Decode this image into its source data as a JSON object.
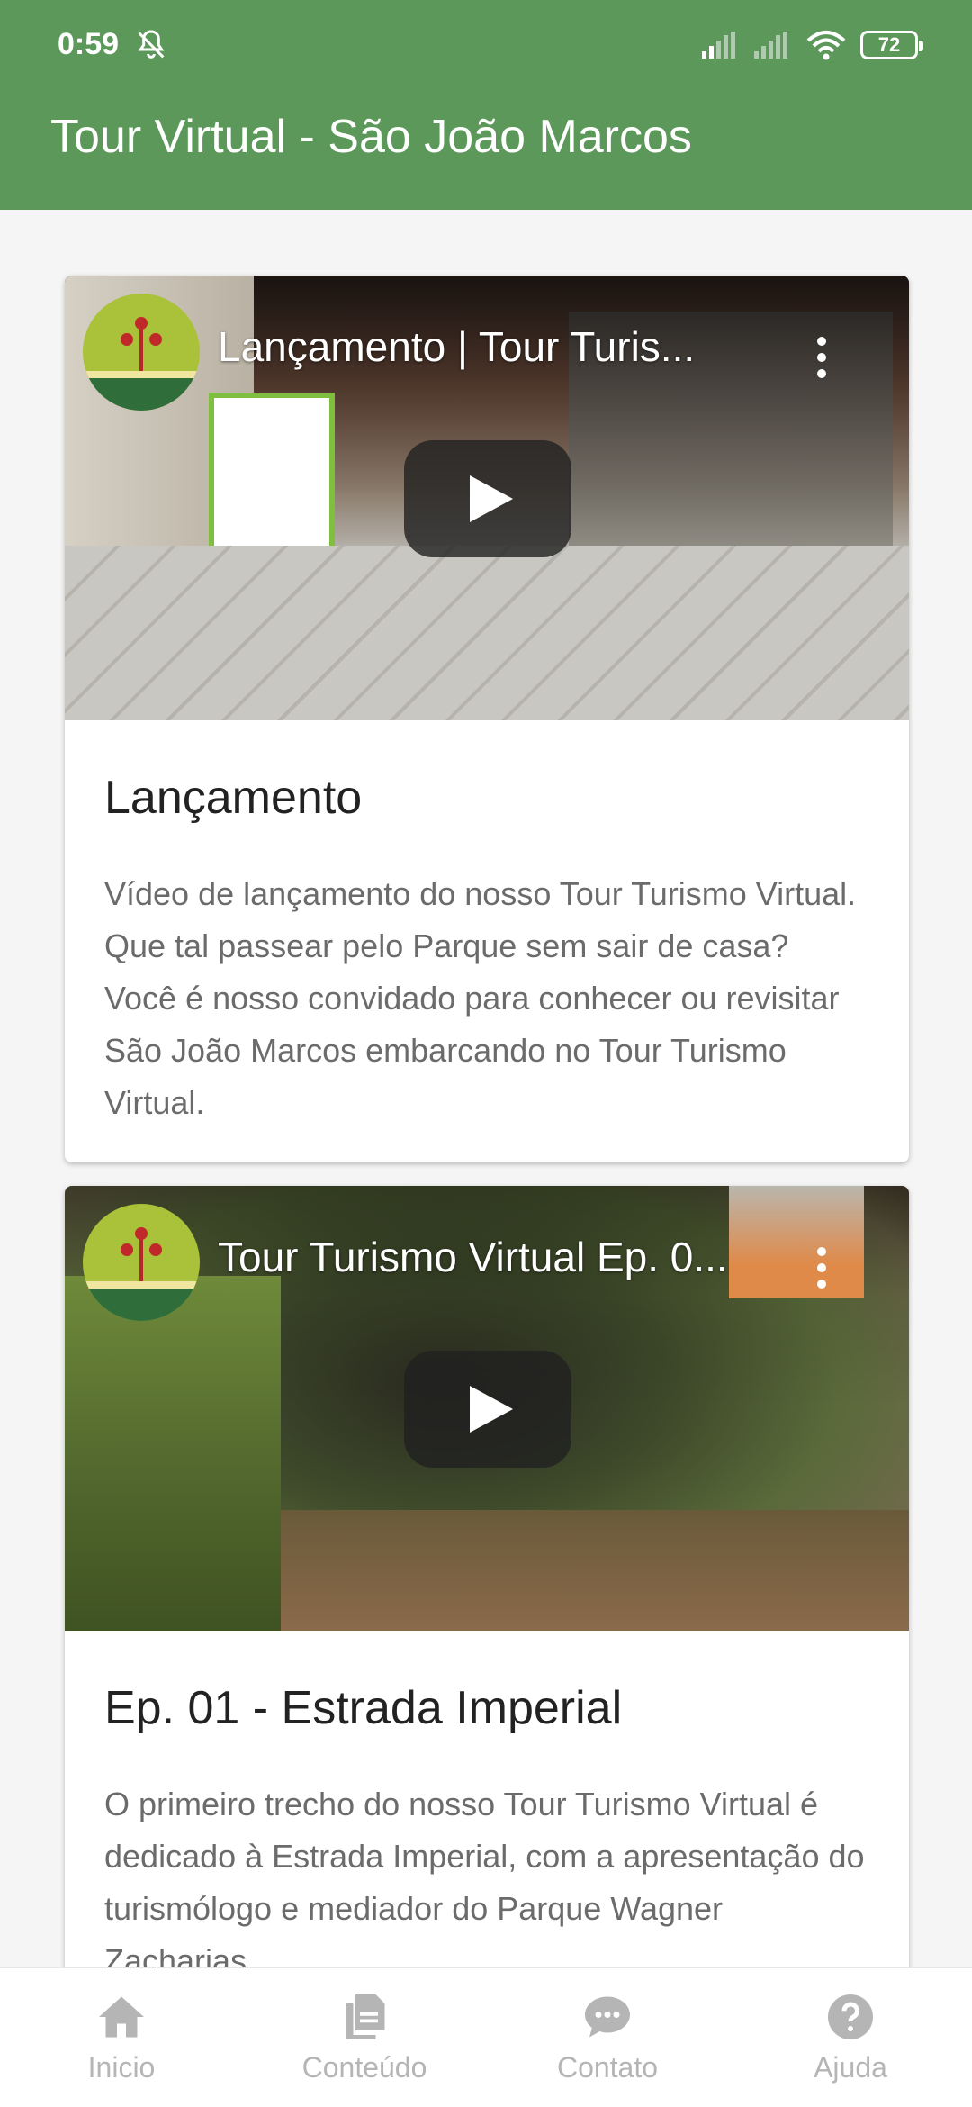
{
  "status_bar": {
    "time": "0:59",
    "battery": "72"
  },
  "app_bar": {
    "title": "Tour Virtual - São João Marcos",
    "color": "#5b985a"
  },
  "videos": [
    {
      "video_title": "Lançamento | Tour Turis...",
      "card_title": "Lançamento",
      "description": "Vídeo de lançamento do nosso Tour Turismo Virtual. Que tal passear pelo Parque sem sair de casa? Você é nosso convidado para conhecer ou revisitar São João Marcos embarcando no Tour Turismo Virtual."
    },
    {
      "video_title": "Tour Turismo Virtual Ep. 0...",
      "card_title": "Ep. 01 - Estrada Imperial",
      "description": "O primeiro trecho do nosso Tour Turismo Virtual é dedicado à Estrada Imperial, com a apresentação do turismólogo e mediador do Parque Wagner Zacharias."
    }
  ],
  "bottom_nav": [
    {
      "label": "Inicio",
      "icon": "home-icon"
    },
    {
      "label": "Conteúdo",
      "icon": "documents-icon"
    },
    {
      "label": "Contato",
      "icon": "chat-icon"
    },
    {
      "label": "Ajuda",
      "icon": "help-icon"
    }
  ]
}
